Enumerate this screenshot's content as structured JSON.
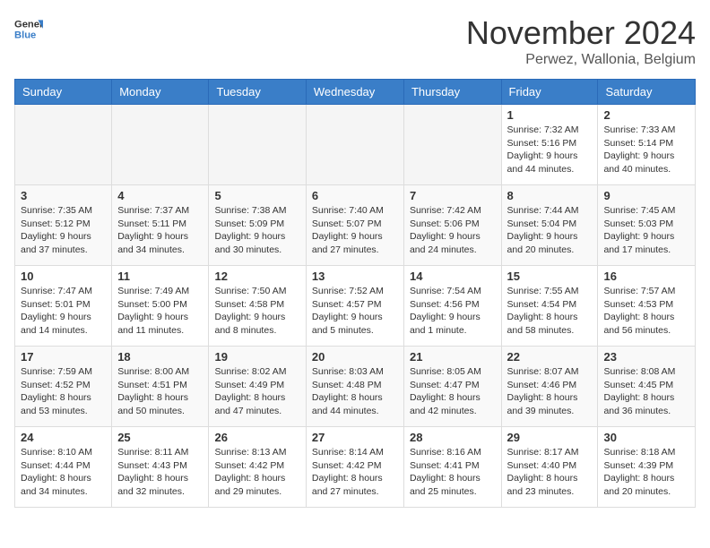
{
  "header": {
    "logo_line1": "General",
    "logo_line2": "Blue",
    "month": "November 2024",
    "location": "Perwez, Wallonia, Belgium"
  },
  "weekdays": [
    "Sunday",
    "Monday",
    "Tuesday",
    "Wednesday",
    "Thursday",
    "Friday",
    "Saturday"
  ],
  "weeks": [
    [
      {
        "day": "",
        "sunrise": "",
        "sunset": "",
        "daylight": ""
      },
      {
        "day": "",
        "sunrise": "",
        "sunset": "",
        "daylight": ""
      },
      {
        "day": "",
        "sunrise": "",
        "sunset": "",
        "daylight": ""
      },
      {
        "day": "",
        "sunrise": "",
        "sunset": "",
        "daylight": ""
      },
      {
        "day": "",
        "sunrise": "",
        "sunset": "",
        "daylight": ""
      },
      {
        "day": "1",
        "sunrise": "Sunrise: 7:32 AM",
        "sunset": "Sunset: 5:16 PM",
        "daylight": "Daylight: 9 hours and 44 minutes."
      },
      {
        "day": "2",
        "sunrise": "Sunrise: 7:33 AM",
        "sunset": "Sunset: 5:14 PM",
        "daylight": "Daylight: 9 hours and 40 minutes."
      }
    ],
    [
      {
        "day": "3",
        "sunrise": "Sunrise: 7:35 AM",
        "sunset": "Sunset: 5:12 PM",
        "daylight": "Daylight: 9 hours and 37 minutes."
      },
      {
        "day": "4",
        "sunrise": "Sunrise: 7:37 AM",
        "sunset": "Sunset: 5:11 PM",
        "daylight": "Daylight: 9 hours and 34 minutes."
      },
      {
        "day": "5",
        "sunrise": "Sunrise: 7:38 AM",
        "sunset": "Sunset: 5:09 PM",
        "daylight": "Daylight: 9 hours and 30 minutes."
      },
      {
        "day": "6",
        "sunrise": "Sunrise: 7:40 AM",
        "sunset": "Sunset: 5:07 PM",
        "daylight": "Daylight: 9 hours and 27 minutes."
      },
      {
        "day": "7",
        "sunrise": "Sunrise: 7:42 AM",
        "sunset": "Sunset: 5:06 PM",
        "daylight": "Daylight: 9 hours and 24 minutes."
      },
      {
        "day": "8",
        "sunrise": "Sunrise: 7:44 AM",
        "sunset": "Sunset: 5:04 PM",
        "daylight": "Daylight: 9 hours and 20 minutes."
      },
      {
        "day": "9",
        "sunrise": "Sunrise: 7:45 AM",
        "sunset": "Sunset: 5:03 PM",
        "daylight": "Daylight: 9 hours and 17 minutes."
      }
    ],
    [
      {
        "day": "10",
        "sunrise": "Sunrise: 7:47 AM",
        "sunset": "Sunset: 5:01 PM",
        "daylight": "Daylight: 9 hours and 14 minutes."
      },
      {
        "day": "11",
        "sunrise": "Sunrise: 7:49 AM",
        "sunset": "Sunset: 5:00 PM",
        "daylight": "Daylight: 9 hours and 11 minutes."
      },
      {
        "day": "12",
        "sunrise": "Sunrise: 7:50 AM",
        "sunset": "Sunset: 4:58 PM",
        "daylight": "Daylight: 9 hours and 8 minutes."
      },
      {
        "day": "13",
        "sunrise": "Sunrise: 7:52 AM",
        "sunset": "Sunset: 4:57 PM",
        "daylight": "Daylight: 9 hours and 5 minutes."
      },
      {
        "day": "14",
        "sunrise": "Sunrise: 7:54 AM",
        "sunset": "Sunset: 4:56 PM",
        "daylight": "Daylight: 9 hours and 1 minute."
      },
      {
        "day": "15",
        "sunrise": "Sunrise: 7:55 AM",
        "sunset": "Sunset: 4:54 PM",
        "daylight": "Daylight: 8 hours and 58 minutes."
      },
      {
        "day": "16",
        "sunrise": "Sunrise: 7:57 AM",
        "sunset": "Sunset: 4:53 PM",
        "daylight": "Daylight: 8 hours and 56 minutes."
      }
    ],
    [
      {
        "day": "17",
        "sunrise": "Sunrise: 7:59 AM",
        "sunset": "Sunset: 4:52 PM",
        "daylight": "Daylight: 8 hours and 53 minutes."
      },
      {
        "day": "18",
        "sunrise": "Sunrise: 8:00 AM",
        "sunset": "Sunset: 4:51 PM",
        "daylight": "Daylight: 8 hours and 50 minutes."
      },
      {
        "day": "19",
        "sunrise": "Sunrise: 8:02 AM",
        "sunset": "Sunset: 4:49 PM",
        "daylight": "Daylight: 8 hours and 47 minutes."
      },
      {
        "day": "20",
        "sunrise": "Sunrise: 8:03 AM",
        "sunset": "Sunset: 4:48 PM",
        "daylight": "Daylight: 8 hours and 44 minutes."
      },
      {
        "day": "21",
        "sunrise": "Sunrise: 8:05 AM",
        "sunset": "Sunset: 4:47 PM",
        "daylight": "Daylight: 8 hours and 42 minutes."
      },
      {
        "day": "22",
        "sunrise": "Sunrise: 8:07 AM",
        "sunset": "Sunset: 4:46 PM",
        "daylight": "Daylight: 8 hours and 39 minutes."
      },
      {
        "day": "23",
        "sunrise": "Sunrise: 8:08 AM",
        "sunset": "Sunset: 4:45 PM",
        "daylight": "Daylight: 8 hours and 36 minutes."
      }
    ],
    [
      {
        "day": "24",
        "sunrise": "Sunrise: 8:10 AM",
        "sunset": "Sunset: 4:44 PM",
        "daylight": "Daylight: 8 hours and 34 minutes."
      },
      {
        "day": "25",
        "sunrise": "Sunrise: 8:11 AM",
        "sunset": "Sunset: 4:43 PM",
        "daylight": "Daylight: 8 hours and 32 minutes."
      },
      {
        "day": "26",
        "sunrise": "Sunrise: 8:13 AM",
        "sunset": "Sunset: 4:42 PM",
        "daylight": "Daylight: 8 hours and 29 minutes."
      },
      {
        "day": "27",
        "sunrise": "Sunrise: 8:14 AM",
        "sunset": "Sunset: 4:42 PM",
        "daylight": "Daylight: 8 hours and 27 minutes."
      },
      {
        "day": "28",
        "sunrise": "Sunrise: 8:16 AM",
        "sunset": "Sunset: 4:41 PM",
        "daylight": "Daylight: 8 hours and 25 minutes."
      },
      {
        "day": "29",
        "sunrise": "Sunrise: 8:17 AM",
        "sunset": "Sunset: 4:40 PM",
        "daylight": "Daylight: 8 hours and 23 minutes."
      },
      {
        "day": "30",
        "sunrise": "Sunrise: 8:18 AM",
        "sunset": "Sunset: 4:39 PM",
        "daylight": "Daylight: 8 hours and 20 minutes."
      }
    ]
  ]
}
